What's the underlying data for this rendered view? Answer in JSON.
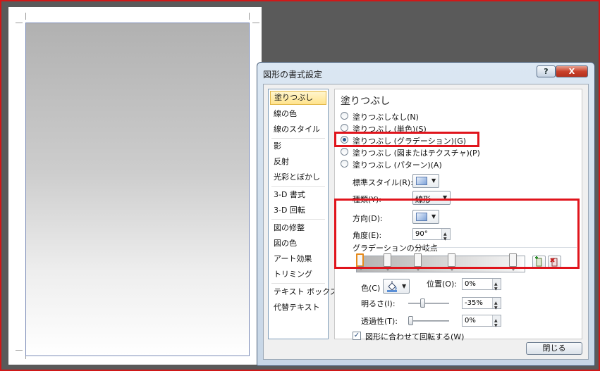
{
  "dialog": {
    "title": "図形の書式設定",
    "help_label": "?",
    "close_label": "X",
    "close_button": "閉じる"
  },
  "categories": [
    {
      "label": "塗りつぶし",
      "selected": true
    },
    {
      "label": "線の色"
    },
    {
      "label": "線のスタイル"
    },
    {
      "label": "影"
    },
    {
      "label": "反射"
    },
    {
      "label": "光彩とぼかし"
    },
    {
      "label": "3-D 書式"
    },
    {
      "label": "3-D 回転"
    },
    {
      "label": "図の修整"
    },
    {
      "label": "図の色"
    },
    {
      "label": "アート効果"
    },
    {
      "label": "トリミング"
    },
    {
      "label": "テキスト ボックス"
    },
    {
      "label": "代替テキスト"
    }
  ],
  "fill": {
    "heading": "塗りつぶし",
    "options": [
      {
        "label": "塗りつぶしなし(N)"
      },
      {
        "label": "塗りつぶし (単色)(S)"
      },
      {
        "label": "塗りつぶし (グラデーション)(G)",
        "selected": true
      },
      {
        "label": "塗りつぶし (図またはテクスチャ)(P)"
      },
      {
        "label": "塗りつぶし (パターン)(A)"
      }
    ],
    "preset_label": "標準スタイル(R):",
    "type_label": "種類(Y):",
    "type_value": "線形",
    "direction_label": "方向(D):",
    "angle_label": "角度(E):",
    "angle_value": "90°",
    "stops_label": "グラデーションの分岐点",
    "stops": [
      0,
      0.17,
      0.36,
      0.57,
      0.95
    ],
    "color_label": "色(C)",
    "position_label": "位置(O):",
    "position_value": "0%",
    "brightness_label": "明るさ(I):",
    "brightness_value": "-35%",
    "brightness_level": -35,
    "transparency_label": "透過性(T):",
    "transparency_value": "0%",
    "transparency_level": 0,
    "rotate_label": "図形に合わせて回転する(W)",
    "rotate_checked": true,
    "check_mark": "✓",
    "dropdown_arrow": "▼",
    "spin_up": "▲",
    "spin_down": "▼"
  },
  "icons": {
    "add_stop": "add-gradient-stop-icon",
    "remove_stop": "remove-gradient-stop-icon",
    "paint_bucket": "paint-bucket-icon"
  },
  "colors": {
    "highlight": "#e0141c",
    "selected_stop": "#e58a1c",
    "category_selected": "#ffe38c"
  }
}
